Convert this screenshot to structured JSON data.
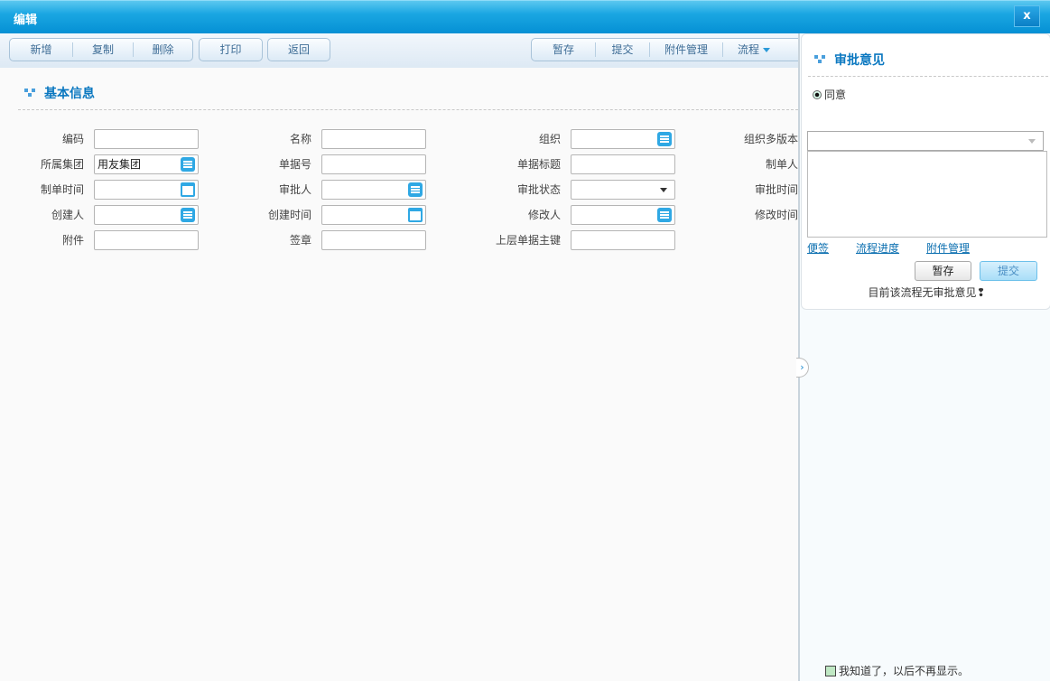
{
  "window": {
    "title": "编辑",
    "close": "x"
  },
  "toolbar": {
    "group1": [
      "新增",
      "复制",
      "删除"
    ],
    "print": "打印",
    "back": "返回",
    "group2": [
      "暂存",
      "提交",
      "附件管理",
      "流程"
    ]
  },
  "section": {
    "title": "基本信息"
  },
  "form": {
    "col1": [
      {
        "label": "编码",
        "value": ""
      },
      {
        "label": "所属集团",
        "value": "用友集团",
        "type": "ref"
      },
      {
        "label": "制单时间",
        "value": "",
        "type": "date"
      },
      {
        "label": "创建人",
        "value": "",
        "type": "ref"
      },
      {
        "label": "附件",
        "value": ""
      }
    ],
    "col2": [
      {
        "label": "名称",
        "value": ""
      },
      {
        "label": "单据号",
        "value": ""
      },
      {
        "label": "审批人",
        "value": "",
        "type": "ref"
      },
      {
        "label": "创建时间",
        "value": "",
        "type": "date"
      },
      {
        "label": "签章",
        "value": ""
      }
    ],
    "col3": [
      {
        "label": "组织",
        "value": "",
        "type": "ref"
      },
      {
        "label": "单据标题",
        "value": ""
      },
      {
        "label": "审批状态",
        "value": "",
        "type": "select"
      },
      {
        "label": "修改人",
        "value": "",
        "type": "ref"
      },
      {
        "label": "上层单据主键",
        "value": ""
      }
    ],
    "col4": [
      {
        "label": "组织多版本"
      },
      {
        "label": "制单人"
      },
      {
        "label": "审批时间"
      },
      {
        "label": "修改时间"
      }
    ]
  },
  "approval": {
    "title": "审批意见",
    "option": "同意",
    "option_selected": true,
    "select_value": "",
    "comment": "",
    "links": [
      "便签",
      "流程进度",
      "附件管理"
    ],
    "save": "暂存",
    "submit": "提交",
    "note": "目前该流程无审批意见❢",
    "dont_show": "我知道了，以后不再显示。",
    "dont_show_checked": false
  },
  "colors": {
    "accent": "#0b78c0",
    "titlebar": "#1aa6e2"
  }
}
